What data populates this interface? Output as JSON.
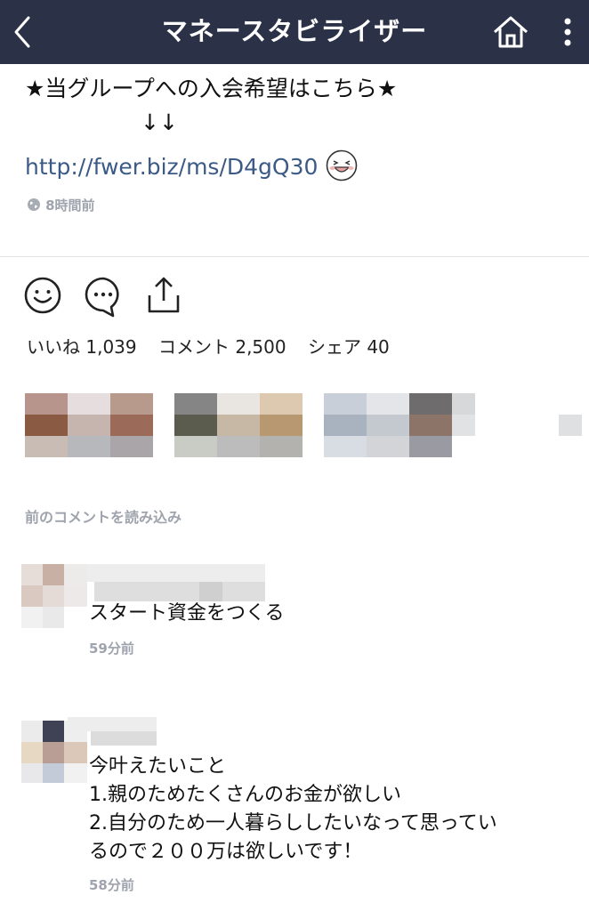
{
  "header": {
    "title": "マネースタビライザー",
    "back_icon": "chevron-left-icon",
    "home_icon": "home-icon",
    "more_icon": "vertical-dots-icon",
    "background": "#2b3247"
  },
  "post": {
    "text_line1": "★当グループへの入会希望はこちら★",
    "text_line2": "↓↓",
    "link": "http://fwer.biz/ms/D4gQ30",
    "emoji_icon": "grinning-face-icon",
    "time": "8時間前",
    "link_color": "#3b5a86"
  },
  "actions": {
    "react_icon": "smiley-icon",
    "comment_icon": "speech-bubble-icon",
    "share_icon": "share-icon"
  },
  "stats": {
    "likes": "いいね 1,039",
    "comments": "コメント 2,500",
    "shares": "シェア 40"
  },
  "comments_section": {
    "load_previous": "前のコメントを読み込み",
    "comments": [
      {
        "text_lines": [
          "スタート資金をつくる"
        ],
        "time": "59分前"
      },
      {
        "text_lines": [
          "今叶えたいこと",
          "1.親のためたくさんのお金が欲しい",
          "2.自分のため一人暮らししたいなって思ってい",
          "るので２００万は欲しいです！"
        ],
        "time": "58分前"
      }
    ]
  }
}
